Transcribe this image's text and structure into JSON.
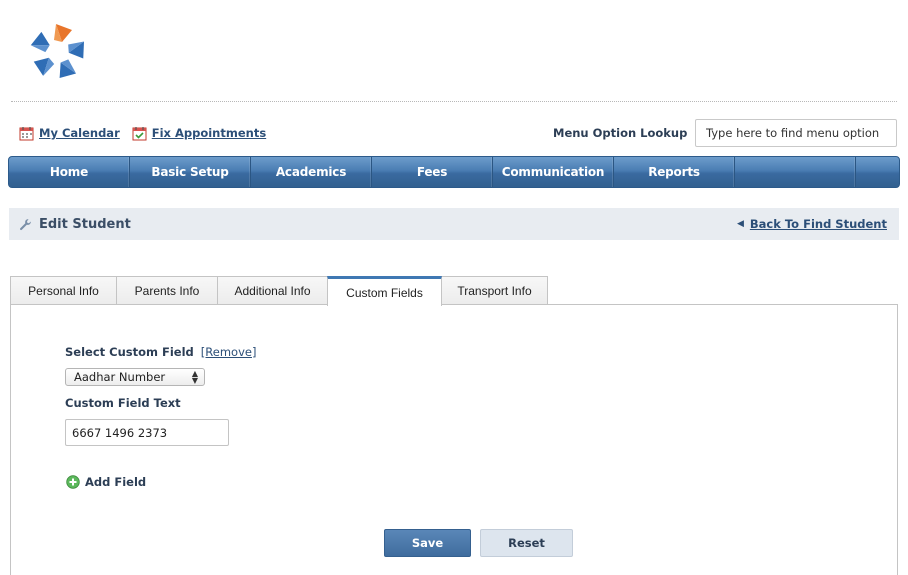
{
  "colors": {
    "nav_bar": "#3a6aa0",
    "link": "#2c4f78",
    "title_bar_bg": "#e8ecf1",
    "save_button": "#4a77a8",
    "reset_button": "#dde5ee",
    "logo_orange": "#e8752b",
    "logo_blue": "#2f6db5"
  },
  "header": {
    "logo_icon": "star-pinwheel-logo",
    "quick_links": [
      {
        "label": "My Calendar",
        "icon": "calendar-icon"
      },
      {
        "label": "Fix Appointments",
        "icon": "calendar-check-icon"
      }
    ],
    "menu_lookup": {
      "label": "Menu Option Lookup",
      "placeholder": "Type here to find menu option"
    }
  },
  "nav": {
    "items": [
      "Home",
      "Basic Setup",
      "Academics",
      "Fees",
      "Communication",
      "Reports",
      ""
    ]
  },
  "page": {
    "title": "Edit Student",
    "title_icon": "wrench-icon",
    "back_link": "Back To Find Student"
  },
  "tabs": [
    {
      "label": "Personal Info",
      "active": false
    },
    {
      "label": "Parents Info",
      "active": false
    },
    {
      "label": "Additional Info",
      "active": false
    },
    {
      "label": "Custom Fields",
      "active": true
    },
    {
      "label": "Transport Info",
      "active": false
    }
  ],
  "form": {
    "select_label": "Select Custom Field",
    "remove_link": "[Remove]",
    "select_value": "Aadhar Number",
    "text_label": "Custom Field Text",
    "text_value": "6667 1496 2373",
    "add_field": "Add Field",
    "save": "Save",
    "reset": "Reset"
  }
}
